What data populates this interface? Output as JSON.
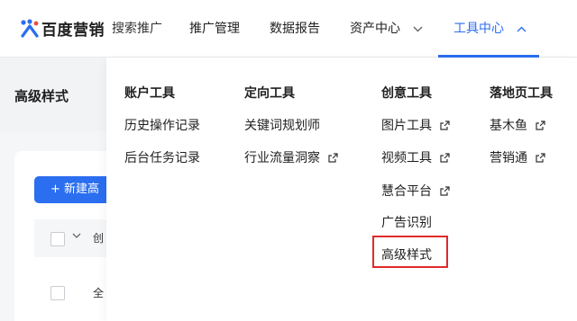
{
  "brand": {
    "name": "百度营销",
    "sub": "搜索推广"
  },
  "nav": {
    "items": [
      {
        "label": "推广管理"
      },
      {
        "label": "数据报告"
      },
      {
        "label": "资产中心"
      },
      {
        "label": "工具中心"
      }
    ],
    "active_color": "#2b6ef0"
  },
  "page": {
    "title": "高级样式",
    "new_button": "+ 新建高",
    "table_header_text": "创",
    "row_text": "全"
  },
  "menu": {
    "columns": [
      {
        "title": "账户工具",
        "items": [
          "历史操作记录",
          "后台任务记录"
        ]
      },
      {
        "title": "定向工具",
        "items": [
          "关键词规划师",
          "行业流量洞察"
        ]
      },
      {
        "title": "创意工具",
        "items": [
          "图片工具",
          "视频工具",
          "慧合平台",
          "广告识别",
          "高级样式"
        ]
      },
      {
        "title": "落地页工具",
        "items": [
          "基木鱼",
          "营销通"
        ]
      }
    ],
    "highlight_color": "#e02a2a"
  }
}
